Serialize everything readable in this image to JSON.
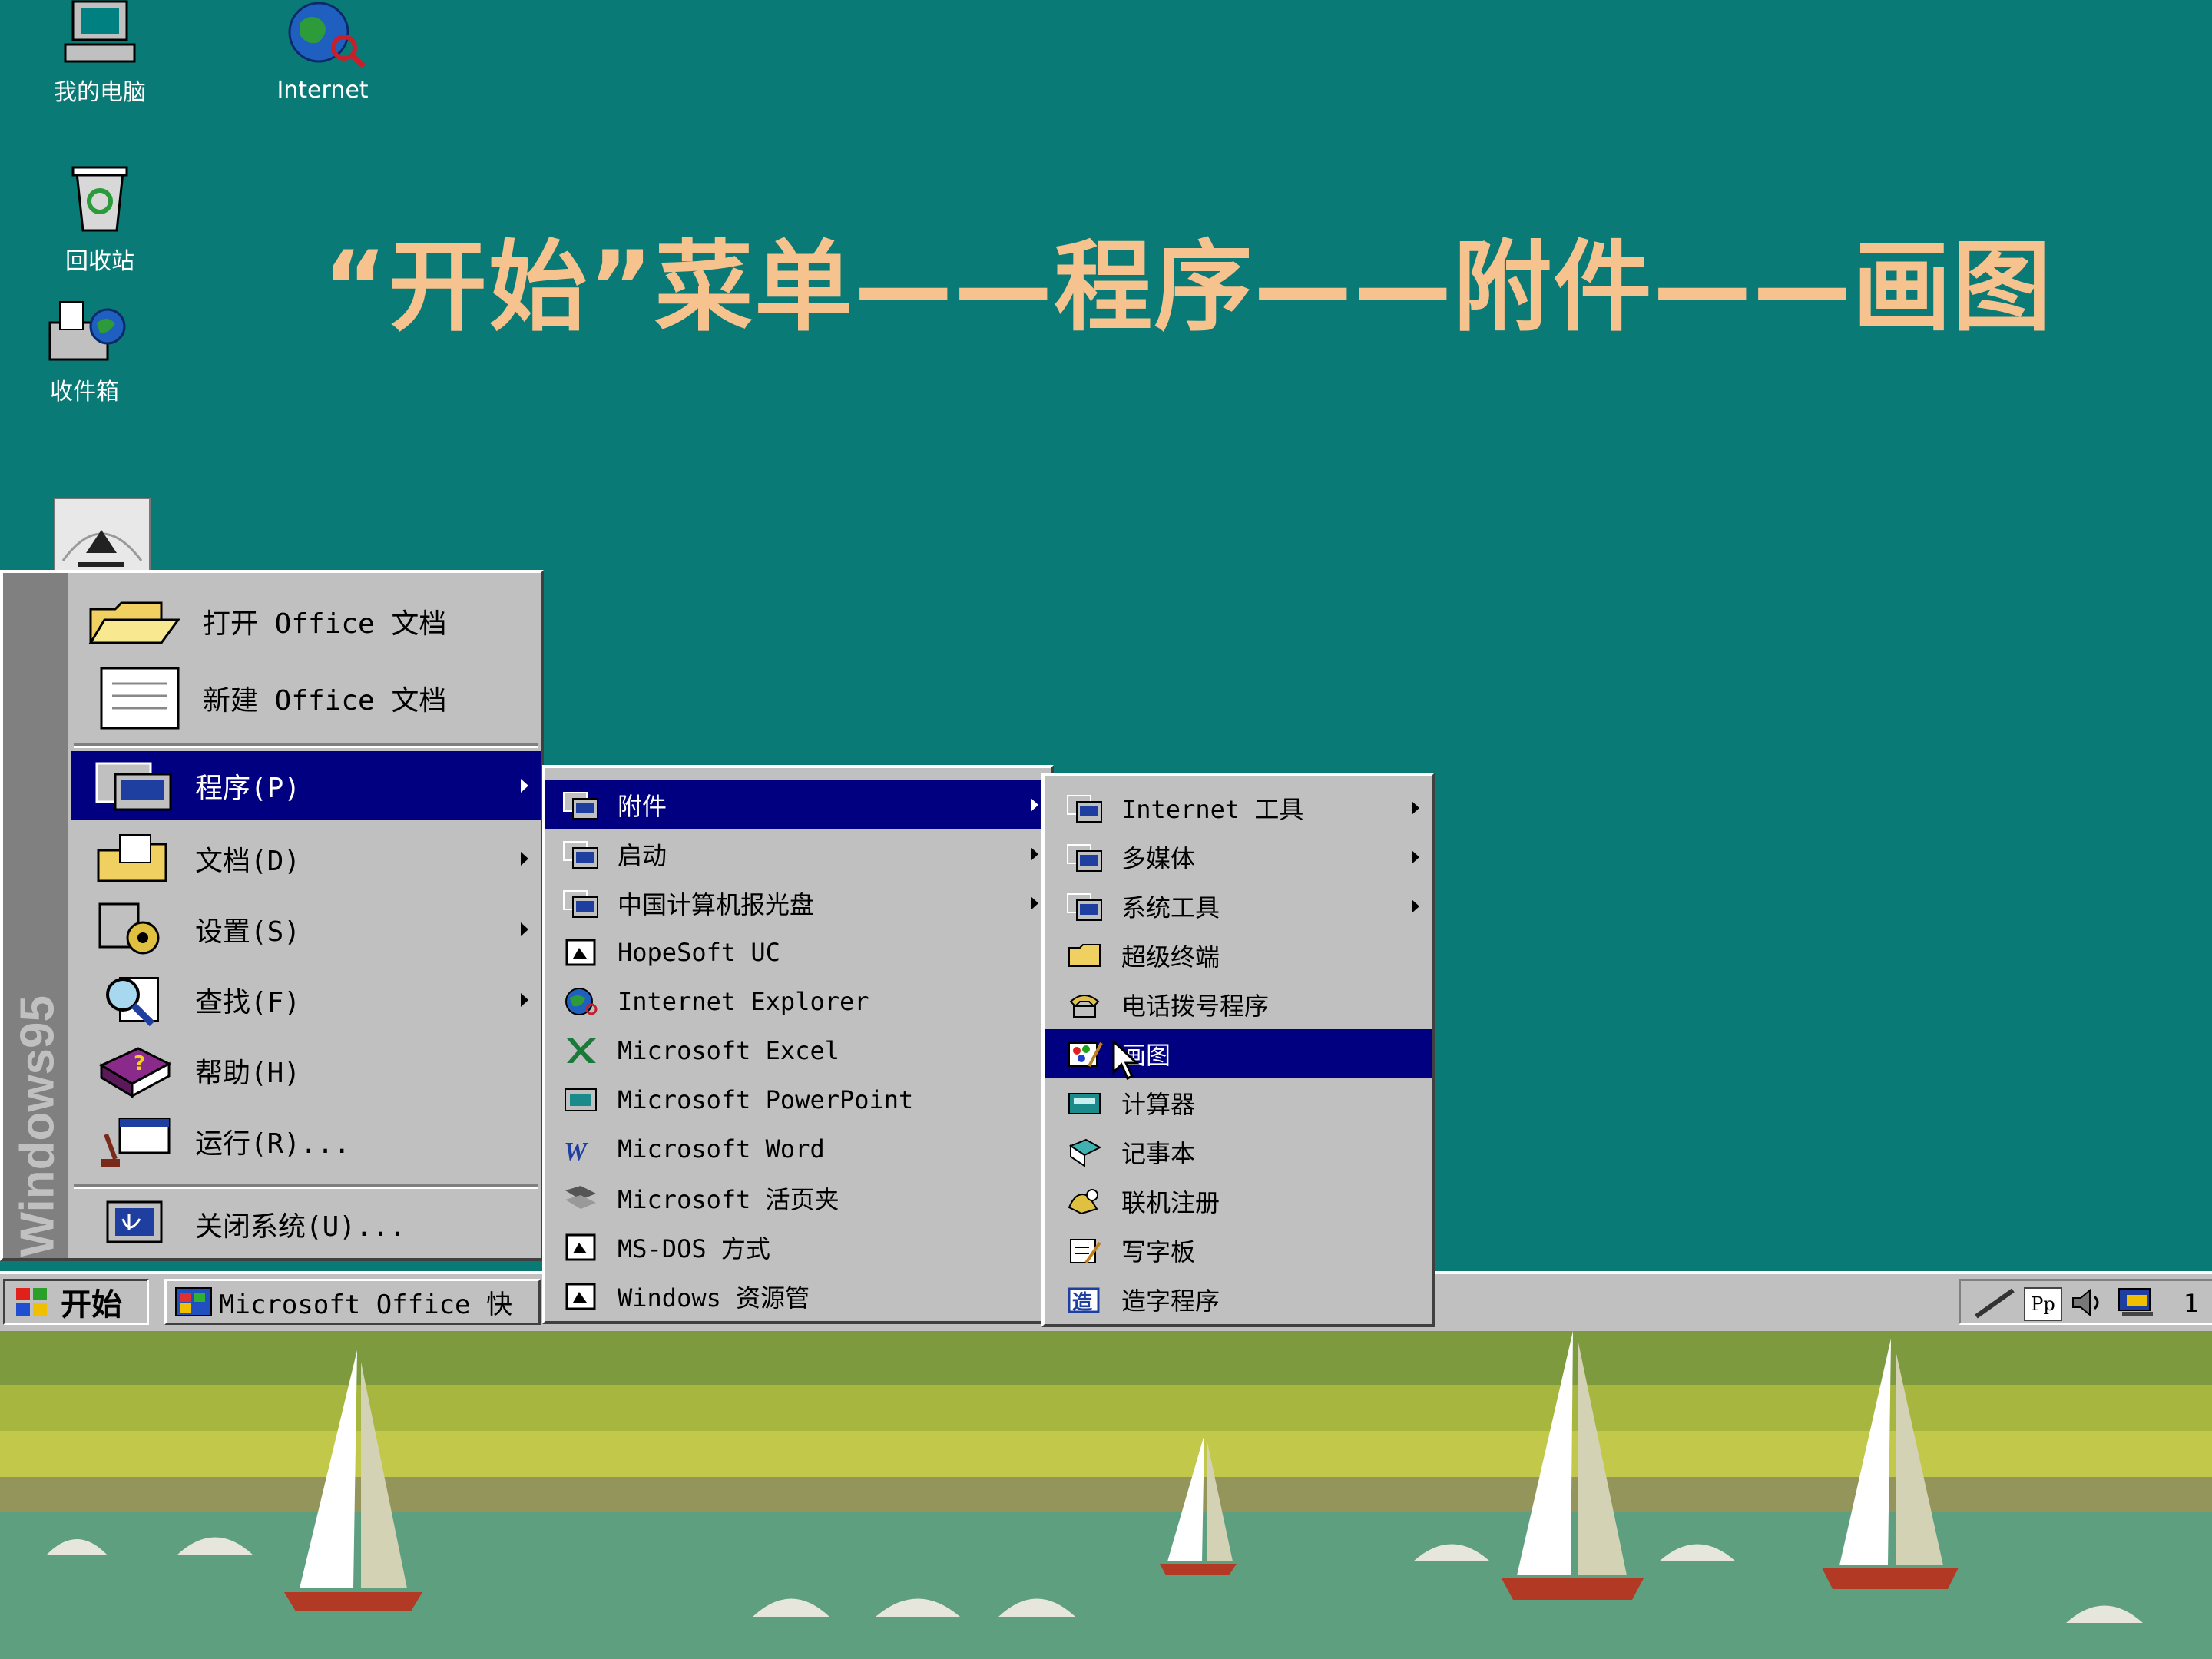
{
  "slide_title": "“开始”菜单——程序——附件——画图",
  "desktop": {
    "icons": [
      "我的电脑",
      "Internet",
      "回收站",
      "收件箱"
    ]
  },
  "start_menu": {
    "side_banner": "Windows95",
    "items": [
      {
        "label": "打开 Office 文档",
        "icon": "open-folder-icon"
      },
      {
        "label": "新建 Office 文档",
        "icon": "new-document-icon"
      },
      {
        "label": "程序(P)",
        "icon": "programs-icon",
        "submenu": true,
        "selected": true
      },
      {
        "label": "文档(D)",
        "icon": "documents-icon",
        "submenu": true
      },
      {
        "label": "设置(S)",
        "icon": "settings-icon",
        "submenu": true
      },
      {
        "label": "查找(F)",
        "icon": "find-icon",
        "submenu": true
      },
      {
        "label": "帮助(H)",
        "icon": "help-icon"
      },
      {
        "label": "运行(R)...",
        "icon": "run-icon"
      },
      {
        "label": "关闭系统(U)...",
        "icon": "shutdown-icon"
      }
    ]
  },
  "programs_menu": {
    "items": [
      {
        "label": "附件",
        "icon": "program-group-icon",
        "submenu": true,
        "selected": true
      },
      {
        "label": "启动",
        "icon": "program-group-icon",
        "submenu": true
      },
      {
        "label": "中国计算机报光盘",
        "icon": "program-group-icon",
        "submenu": true
      },
      {
        "label": "HopeSoft UC",
        "icon": "app-icon"
      },
      {
        "label": "Internet Explorer",
        "icon": "ie-icon"
      },
      {
        "label": "Microsoft Excel",
        "icon": "excel-icon"
      },
      {
        "label": "Microsoft PowerPoint",
        "icon": "powerpoint-icon"
      },
      {
        "label": "Microsoft Word",
        "icon": "word-icon"
      },
      {
        "label": "Microsoft 活页夹",
        "icon": "binder-icon"
      },
      {
        "label": "MS-DOS 方式",
        "icon": "msdos-icon"
      },
      {
        "label": "Windows 资源管",
        "icon": "explorer-icon"
      }
    ]
  },
  "accessories_menu": {
    "items": [
      {
        "label": "Internet 工具",
        "icon": "program-group-icon",
        "submenu": true
      },
      {
        "label": "多媒体",
        "icon": "program-group-icon",
        "submenu": true
      },
      {
        "label": "系统工具",
        "icon": "program-group-icon",
        "submenu": true
      },
      {
        "label": "超级终端",
        "icon": "folder-icon"
      },
      {
        "label": "电话拨号程序",
        "icon": "phone-dialer-icon"
      },
      {
        "label": "画图",
        "icon": "paint-icon",
        "selected": true
      },
      {
        "label": "计算器",
        "icon": "calculator-icon"
      },
      {
        "label": "记事本",
        "icon": "notepad-icon"
      },
      {
        "label": "联机注册",
        "icon": "online-registration-icon"
      },
      {
        "label": "写字板",
        "icon": "wordpad-icon"
      },
      {
        "label": "造字程序",
        "icon": "char-editor-icon"
      }
    ]
  },
  "taskbar": {
    "start_label": "开始",
    "task_button": "Microsoft Office 快",
    "clock_partial": "1"
  },
  "colors": {
    "desktop": "#0a7a76",
    "menu_face": "#c0c0c0",
    "highlight": "#000080",
    "title": "#f6c38e"
  }
}
